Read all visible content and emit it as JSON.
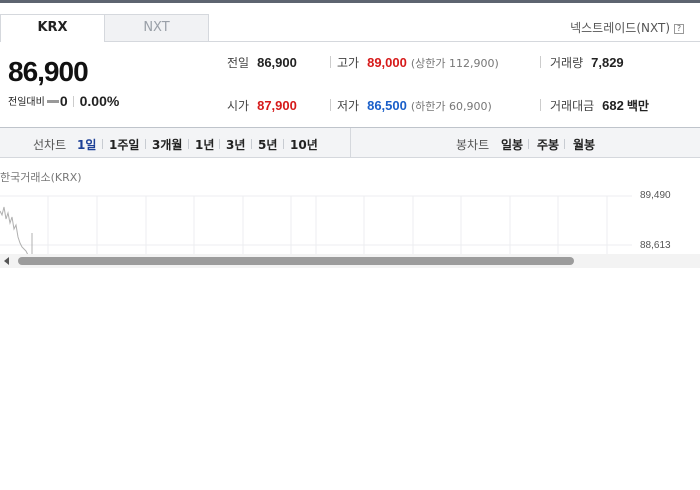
{
  "market_tabs": {
    "krx": "KRX",
    "nxt": "NXT"
  },
  "nxt_link": {
    "label": "넥스트레이드(NXT)",
    "help": "?"
  },
  "price": {
    "current": "86,900",
    "change_label": "전일대비",
    "change_value": "0",
    "change_pct": "0.00%"
  },
  "stats": {
    "prev_close": {
      "label": "전일",
      "value": "86,900"
    },
    "high": {
      "label": "고가",
      "value": "89,000",
      "limit_label": "(상한가 112,900)"
    },
    "volume": {
      "label": "거래량",
      "value": "7,829"
    },
    "open": {
      "label": "시가",
      "value": "87,900"
    },
    "low": {
      "label": "저가",
      "value": "86,500",
      "limit_label": "(하한가 60,900)"
    },
    "amount": {
      "label": "거래대금",
      "value": "682",
      "unit": "백만"
    }
  },
  "line_chart_periods": {
    "title": "선차트",
    "items": [
      "1일",
      "1주일",
      "3개월",
      "1년",
      "3년",
      "5년",
      "10년"
    ],
    "active": "1일"
  },
  "candle_chart_periods": {
    "title": "봉차트",
    "items": [
      "일봉",
      "주봉",
      "월봉"
    ]
  },
  "chart": {
    "source_label": "한국거래소(KRX)",
    "y_labels": [
      "89,490",
      "88,613"
    ]
  },
  "colors": {
    "up": "#d61a1a",
    "down": "#1a5fc9",
    "active_period": "#1c3f96"
  }
}
